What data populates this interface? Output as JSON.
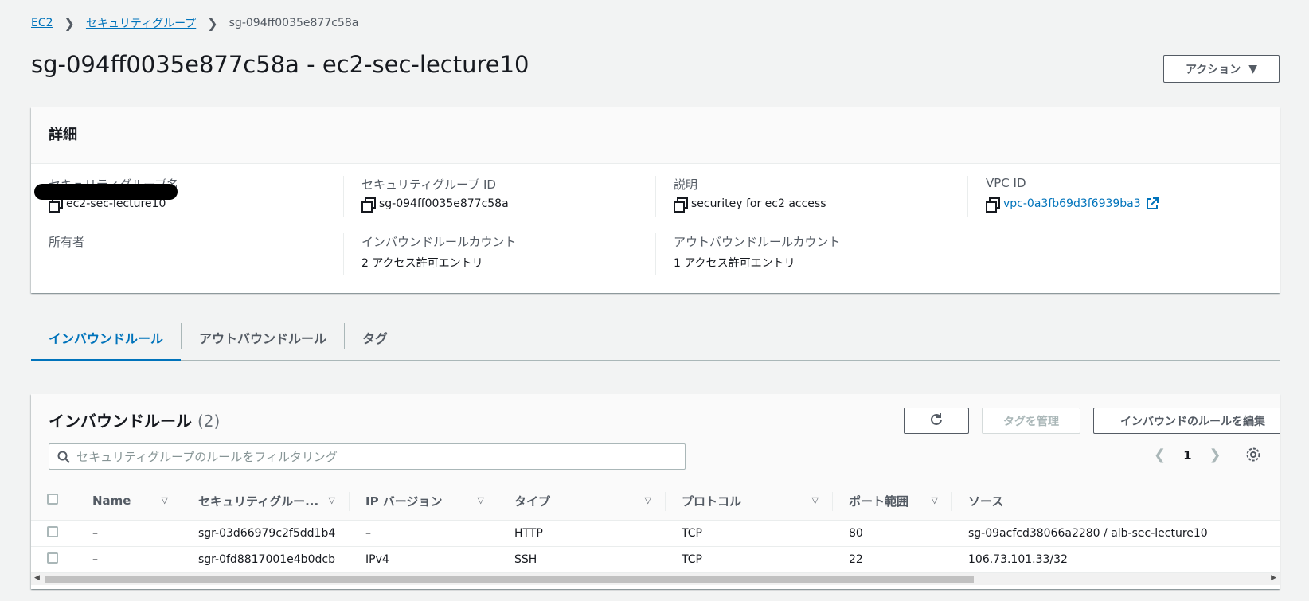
{
  "breadcrumb": {
    "root": "EC2",
    "sep": "❯",
    "section": "セキュリティグループ",
    "current": "sg-094ff0035e877c58a"
  },
  "header": {
    "title": "sg-094ff0035e877c58a - ec2-sec-lecture10",
    "actions_label": "アクション"
  },
  "details": {
    "title": "詳細",
    "sg_name_label": "セキュリティグループ名",
    "sg_name_value": "ec2-sec-lecture10",
    "sg_id_label": "セキュリティグループ ID",
    "sg_id_value": "sg-094ff0035e877c58a",
    "desc_label": "説明",
    "desc_value": "securitey for ec2 access",
    "vpc_label": "VPC ID",
    "vpc_value": "vpc-0a3fb69d3f6939ba3",
    "owner_label": "所有者",
    "inbound_count_label": "インバウンドルールカウント",
    "inbound_count_value": "2 アクセス許可エントリ",
    "outbound_count_label": "アウトバウンドルールカウント",
    "outbound_count_value": "1 アクセス許可エントリ"
  },
  "tabs": [
    {
      "label": "インバウンドルール"
    },
    {
      "label": "アウトバウンドルール"
    },
    {
      "label": "タグ"
    }
  ],
  "inbound": {
    "title": "インバウンドルール",
    "count": "(2)",
    "manage_tags_label": "タグを管理",
    "edit_label": "インバウンドのルールを編集",
    "search_placeholder": "セキュリティグループのルールをフィルタリング",
    "page": "1",
    "columns": [
      "Name",
      "セキュリティグルー...",
      "IP バージョン",
      "タイプ",
      "プロトコル",
      "ポート範囲",
      "ソース"
    ],
    "rows": [
      {
        "name": "–",
        "rule_id": "sgr-03d66979c2f5dd1b4",
        "ip_version": "–",
        "type": "HTTP",
        "protocol": "TCP",
        "port": "80",
        "source": "sg-09acfcd38066a2280 / alb-sec-lecture10"
      },
      {
        "name": "–",
        "rule_id": "sgr-0fd8817001e4b0dcb",
        "ip_version": "IPv4",
        "type": "SSH",
        "protocol": "TCP",
        "port": "22",
        "source": "106.73.101.33/32"
      }
    ]
  },
  "colors": {
    "link": "#0073bb",
    "background": "#f2f3f3",
    "text": "#16191f",
    "muted": "#545b64"
  }
}
